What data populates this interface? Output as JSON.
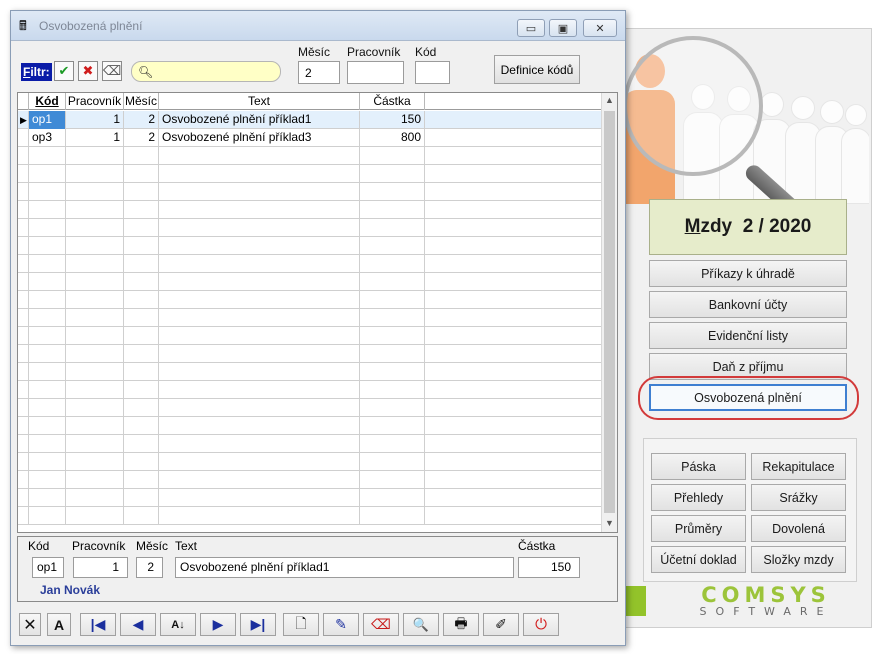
{
  "main_app": {
    "title_label": "Mzdy",
    "title_accesskey_letter": "M",
    "title_rest": "zdy",
    "period": "2 / 2020",
    "menu": [
      "Příkazy k úhradě",
      "Bankovní účty",
      "Evidenční listy",
      "Daň z příjmu",
      "Osvobozená plnění"
    ],
    "active_menu": "Osvobozená plnění",
    "grid_buttons": [
      "Páska",
      "Rekapitulace",
      "Přehledy",
      "Srážky",
      "Průměry",
      "Dovolená",
      "Účetní doklad",
      "Složky mzdy"
    ],
    "logo": {
      "main": "COMSYS",
      "sub": "SOFTWARE"
    },
    "accent_green": "#93c32a",
    "highlight_red": "#d23a3a"
  },
  "dialog": {
    "title": "Osvobozená plnění",
    "titlebar_buttons": {
      "minimize": "▭",
      "restore": "▣",
      "close": "✕"
    },
    "filter": {
      "label_accesskey": "F",
      "label_rest": "iltr:",
      "apply_icon": "check-icon",
      "clear_icon": "cross-icon",
      "eraser_icon": "eraser-icon",
      "search_value": "",
      "month_label": "Měsíc",
      "month_value": "2",
      "employee_label": "Pracovník",
      "employee_value": "",
      "code_label": "Kód",
      "code_value": ""
    },
    "define_codes_button": "Definice kódů",
    "table": {
      "columns": [
        "Kód",
        "Pracovník",
        "Měsíc",
        "Text",
        "Částka"
      ],
      "sorted_column": "Kód",
      "rows": [
        {
          "kod": "op1",
          "pracovnik": "1",
          "mesic": "2",
          "text": "Osvobozené plnění příklad1",
          "castka": "150"
        },
        {
          "kod": "op3",
          "pracovnik": "1",
          "mesic": "2",
          "text": "Osvobozené plnění příklad3",
          "castka": "800"
        }
      ],
      "selected_row": 0
    },
    "detail": {
      "kod_label": "Kód",
      "kod": "op1",
      "pracovnik_label": "Pracovník",
      "pracovnik": "1",
      "mesic_label": "Měsíc",
      "mesic": "2",
      "text_label": "Text",
      "text": "Osvobozené plnění příklad1",
      "castka_label": "Částka",
      "castka": "150",
      "employee_name": "Jan Novák"
    },
    "toolbar": [
      {
        "name": "close-filter-button",
        "glyph": "✕"
      },
      {
        "name": "font-button",
        "glyph": "A"
      },
      {
        "name": "first-record-button",
        "glyph": "|◀"
      },
      {
        "name": "previous-record-button",
        "glyph": "◀"
      },
      {
        "name": "sort-button",
        "glyph": "A↓"
      },
      {
        "name": "next-record-button",
        "glyph": "▶"
      },
      {
        "name": "last-record-button",
        "glyph": "▶|"
      },
      {
        "name": "new-record-button",
        "glyph": "🗋"
      },
      {
        "name": "edit-record-button",
        "glyph": "✎"
      },
      {
        "name": "delete-record-button",
        "glyph": "⌫"
      },
      {
        "name": "find-button",
        "glyph": "🔍"
      },
      {
        "name": "print-button",
        "glyph": "🖶"
      },
      {
        "name": "export-button",
        "glyph": "✐"
      },
      {
        "name": "power-button",
        "glyph": "⏻"
      }
    ]
  }
}
